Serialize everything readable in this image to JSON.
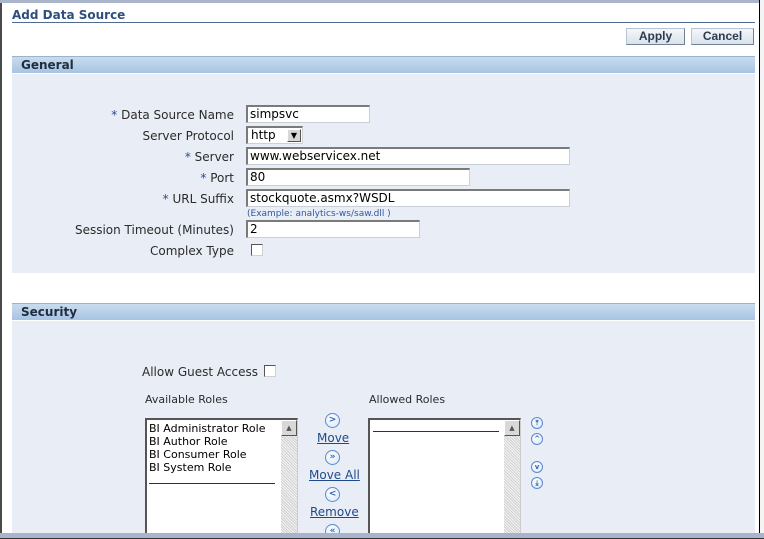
{
  "page": {
    "title": "Add Data Source"
  },
  "toolbar": {
    "apply_label": "Apply",
    "cancel_label": "Cancel"
  },
  "general": {
    "header": "General",
    "required_marker": "*",
    "fields": {
      "data_source_name": {
        "label": "Data Source Name",
        "value": "simpsvc",
        "required": true
      },
      "server_protocol": {
        "label": "Server Protocol",
        "value": "http"
      },
      "server": {
        "label": "Server",
        "value": "www.webservicex.net",
        "required": true
      },
      "port": {
        "label": "Port",
        "value": "80",
        "required": true
      },
      "url_suffix": {
        "label": "URL Suffix",
        "value": "stockquote.asmx?WSDL",
        "required": true,
        "hint": "(Example: analytics-ws/saw.dll )"
      },
      "session_timeout": {
        "label": "Session Timeout (Minutes)",
        "value": "2"
      },
      "complex_type": {
        "label": "Complex Type",
        "checked": false
      }
    }
  },
  "security": {
    "header": "Security",
    "allow_guest_access": {
      "label": "Allow Guest Access",
      "checked": false
    },
    "available_roles": {
      "label": "Available Roles",
      "items": [
        "BI Administrator Role",
        "BI Author Role",
        "BI Consumer Role",
        "BI System Role"
      ]
    },
    "allowed_roles": {
      "label": "Allowed Roles",
      "items": []
    },
    "shuttle": {
      "move_label": "Move",
      "move_all_label": "Move All",
      "remove_label": "Remove",
      "move_icon": ">",
      "move_all_icon": "»",
      "remove_icon": "<",
      "remove_all_icon": "«"
    },
    "reorder": {
      "top_icon": "⤒",
      "up_icon": "^",
      "down_icon": "v",
      "bottom_icon": "⤓"
    }
  },
  "icons": {
    "dropdown_arrow": "▼",
    "scroll_up": "▲"
  }
}
